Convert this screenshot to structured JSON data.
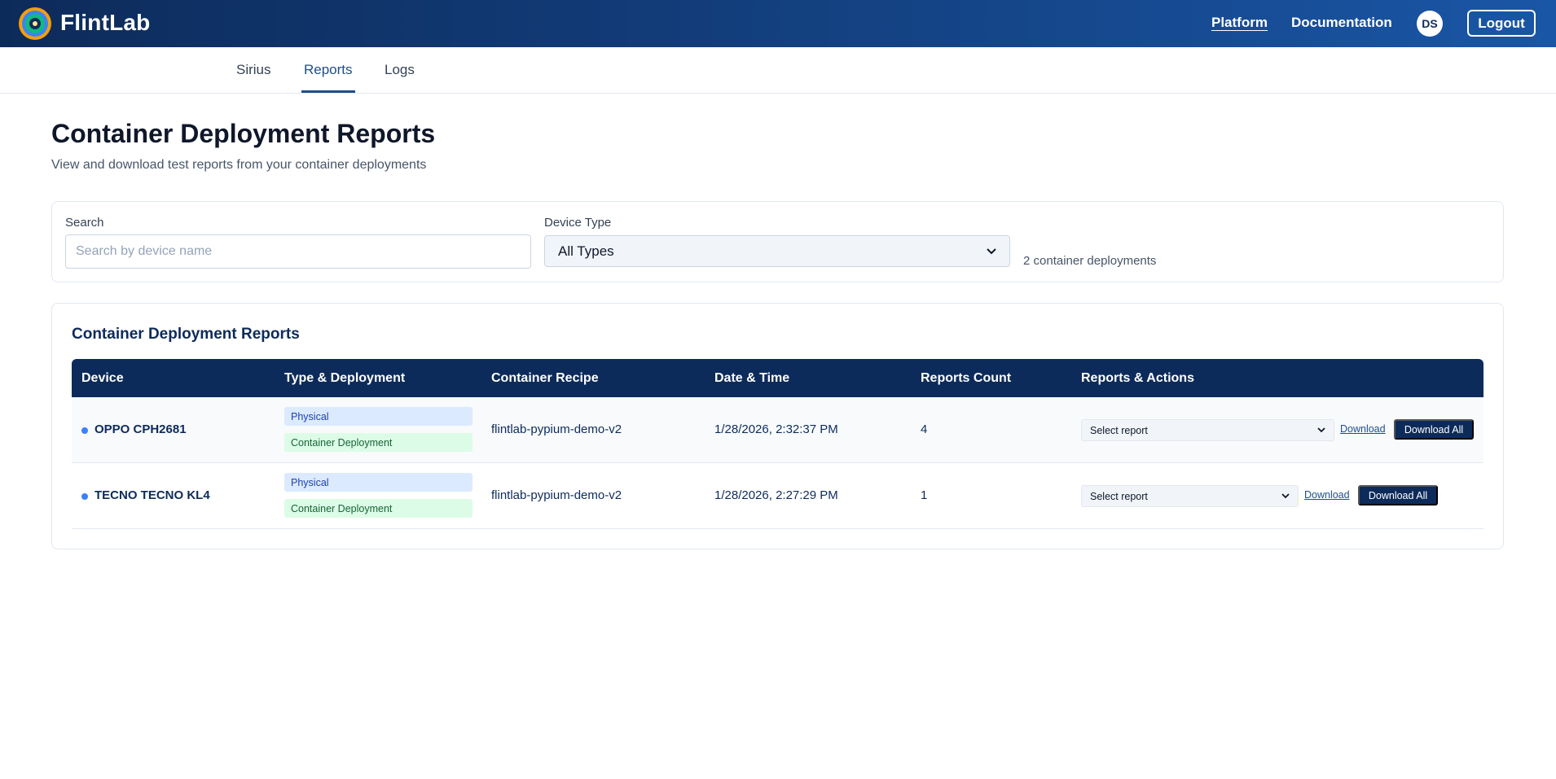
{
  "header": {
    "brand": "FlintLab",
    "nav": {
      "platform": "Platform",
      "documentation": "Documentation"
    },
    "avatar_initials": "DS",
    "logout": "Logout",
    "colors": {
      "bar_start": "#0d2b5a",
      "bar_end": "#1a56a6"
    }
  },
  "subnav": {
    "tabs": [
      {
        "label": "Sirius"
      },
      {
        "label": "Reports",
        "active": true
      },
      {
        "label": "Logs"
      }
    ]
  },
  "page": {
    "title": "Container Deployment Reports",
    "subtitle": "View and download test reports from your container deployments"
  },
  "filters": {
    "search_label": "Search",
    "search_placeholder": "Search by device name",
    "search_value": "",
    "device_type_label": "Device Type",
    "device_type_value": "All Types",
    "count_text": "2 container deployments"
  },
  "table": {
    "title": "Container Deployment Reports",
    "columns": [
      "Device",
      "Type & Deployment",
      "Container Recipe",
      "Date & Time",
      "Reports Count",
      "Reports & Actions"
    ],
    "rows": [
      {
        "device": "OPPO CPH2681",
        "type": "Physical",
        "deployment": "Container Deployment",
        "recipe": "flintlab-pypium-demo-v2",
        "datetime": "1/28/2026, 2:32:37 PM",
        "count": "4",
        "select_label": "Select report",
        "download": "Download",
        "download_all": "Download All"
      },
      {
        "device": "TECNO TECNO KL4",
        "type": "Physical",
        "deployment": "Container Deployment",
        "recipe": "flintlab-pypium-demo-v2",
        "datetime": "1/28/2026, 2:27:29 PM",
        "count": "1",
        "select_label": "Select report",
        "download": "Download",
        "download_all": "Download All"
      }
    ]
  },
  "icons": {
    "logo": "flintlab-logo-icon",
    "chevron": "chevron-down-icon",
    "status": "status-dot-icon"
  }
}
